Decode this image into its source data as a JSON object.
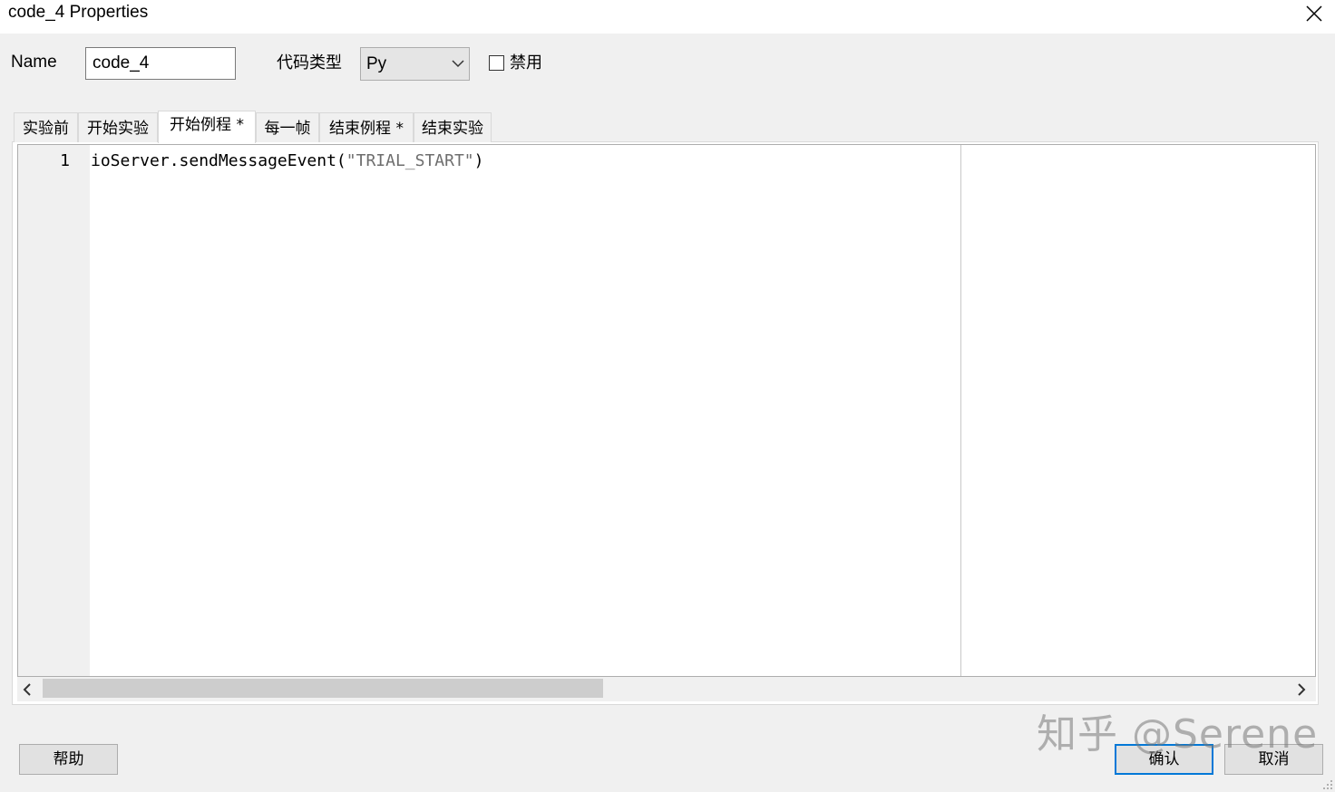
{
  "window": {
    "title": "code_4 Properties"
  },
  "form": {
    "name_label": "Name",
    "name_value": "code_4",
    "code_type_label": "代码类型",
    "code_type_value": "Py",
    "disabled_label": "禁用",
    "disabled_checked": false
  },
  "tabs": [
    {
      "label": "实验前",
      "active": false
    },
    {
      "label": "开始实验",
      "active": false
    },
    {
      "label": "开始例程 *",
      "active": true
    },
    {
      "label": "每一帧",
      "active": false
    },
    {
      "label": "结束例程 *",
      "active": false
    },
    {
      "label": "结束实验",
      "active": false
    }
  ],
  "editor": {
    "line_number": "1",
    "code_prefix": "ioServer.sendMessageEvent(",
    "code_string": "\"TRIAL_START\"",
    "code_suffix": ")"
  },
  "buttons": {
    "help": "帮助",
    "ok": "确认",
    "cancel": "取消"
  },
  "watermark": "知乎 @Serene",
  "icons": {
    "close": "close-icon",
    "dropdown": "chevron-down-icon",
    "scroll_left": "chevron-left-icon",
    "scroll_right": "chevron-right-icon"
  },
  "colors": {
    "default_button_border": "#0078d7",
    "string_literal": "#6e6e6e"
  }
}
